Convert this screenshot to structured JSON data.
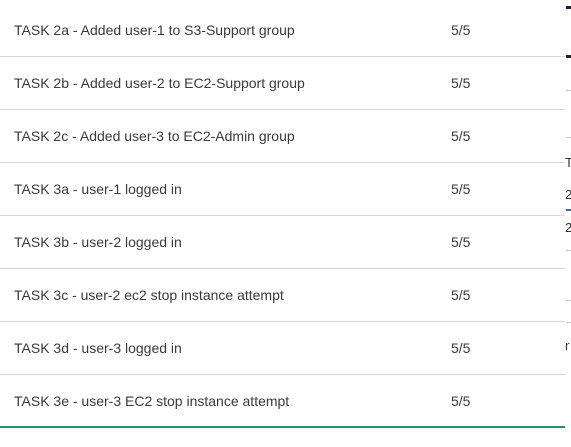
{
  "tasks": [
    {
      "name": "TASK 2a - Added user-1 to S3-Support group",
      "score": "5/5"
    },
    {
      "name": "TASK 2b - Added user-2 to EC2-Support group",
      "score": "5/5"
    },
    {
      "name": "TASK 2c - Added user-3 to EC2-Admin group",
      "score": "5/5"
    },
    {
      "name": "TASK 3a - user-1 logged in",
      "score": "5/5"
    },
    {
      "name": "TASK 3b - user-2 logged in",
      "score": "5/5"
    },
    {
      "name": "TASK 3c - user-2 ec2 stop instance attempt",
      "score": "5/5"
    },
    {
      "name": "TASK 3d - user-3 logged in",
      "score": "5/5"
    },
    {
      "name": "TASK 3e - user-3 EC2 stop instance attempt",
      "score": "5/5"
    }
  ],
  "edge_panel": {
    "glyph_1": "T",
    "glyph_2": "2",
    "glyph_3": "2",
    "glyph_4": "r"
  },
  "colors": {
    "row_divider": "#d7d7d7",
    "bottom_accent": "#2e8b7a",
    "text": "#3a3a3a"
  }
}
